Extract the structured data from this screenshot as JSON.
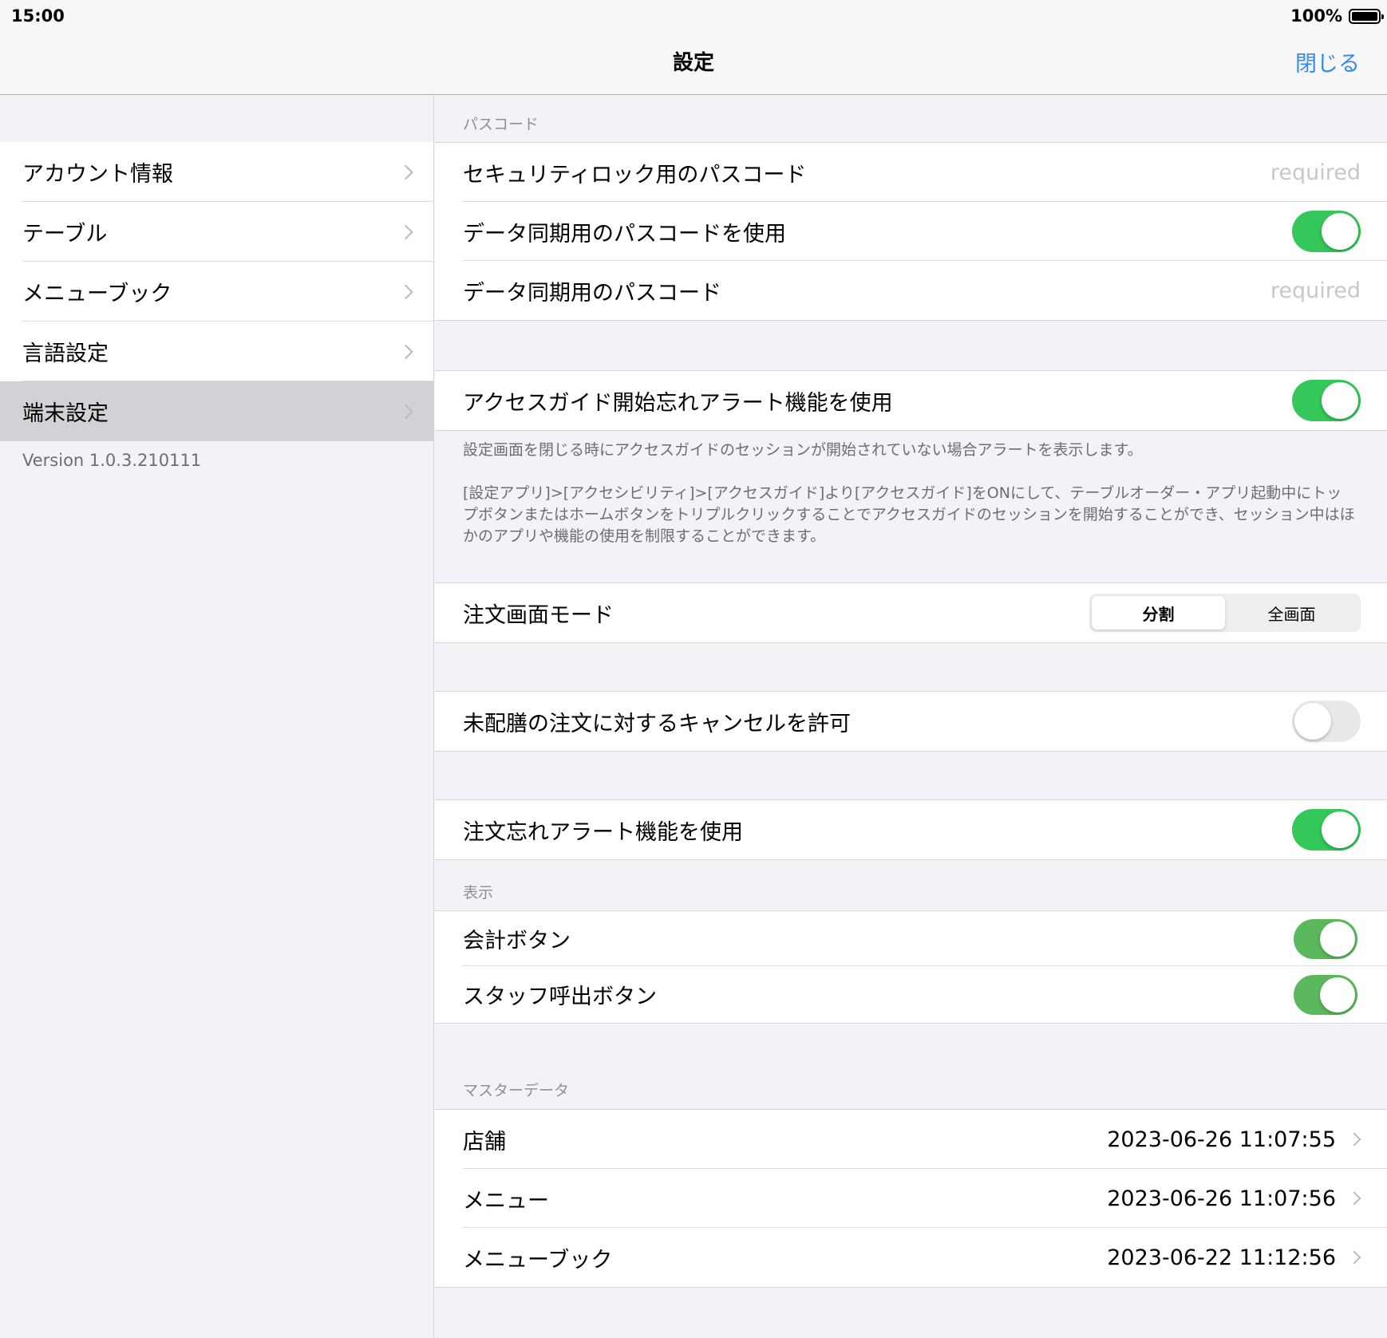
{
  "status_bar": {
    "time": "15:00",
    "battery": "100%"
  },
  "nav": {
    "title": "設定",
    "close_label": "閉じる"
  },
  "sidebar": {
    "items": [
      {
        "label": "アカウント情報"
      },
      {
        "label": "テーブル"
      },
      {
        "label": "メニューブック"
      },
      {
        "label": "言語設定"
      },
      {
        "label": "端末設定",
        "selected": true
      }
    ],
    "version": "Version 1.0.3.210111"
  },
  "passcode": {
    "header": "パスコード",
    "security_lock_label": "セキュリティロック用のパスコード",
    "security_lock_value": "required",
    "use_sync_label": "データ同期用のパスコードを使用",
    "use_sync_on": true,
    "sync_label": "データ同期用のパスコード",
    "sync_value": "required"
  },
  "access_guide": {
    "label": "アクセスガイド開始忘れアラート機能を使用",
    "on": true,
    "footer_1": "設定画面を閉じる時にアクセスガイドのセッションが開始されていない場合アラートを表示します。",
    "footer_2": "[設定アプリ]>[アクセシビリティ]>[アクセスガイド]より[アクセスガイド]をONにして、テーブルオーダー・アプリ起動中にトップボタンまたはホームボタンをトリプルクリックすることでアクセスガイドのセッションを開始することができ、セッション中はほかのアプリや機能の使用を制限することができます。"
  },
  "order_mode": {
    "label": "注文画面モード",
    "options": [
      "分割",
      "全画面"
    ],
    "selected": "分割"
  },
  "cancel_unserved": {
    "label": "未配膳の注文に対するキャンセルを許可",
    "on": false
  },
  "order_alert": {
    "label": "注文忘れアラート機能を使用",
    "on": true
  },
  "display": {
    "header": "表示",
    "checkout_label": "会計ボタン",
    "checkout_on": true,
    "staff_call_label": "スタッフ呼出ボタン",
    "staff_call_on": true
  },
  "master_data": {
    "header": "マスターデータ",
    "rows": [
      {
        "label": "店舗",
        "date": "2023-06-26 11:07:55"
      },
      {
        "label": "メニュー",
        "date": "2023-06-26 11:07:56"
      },
      {
        "label": "メニューブック",
        "date": "2023-06-22 11:12:56"
      }
    ]
  },
  "colors": {
    "accent": "#2f8af2",
    "toggle_on": "#34c759",
    "selected_row": "#d1d1d6"
  }
}
